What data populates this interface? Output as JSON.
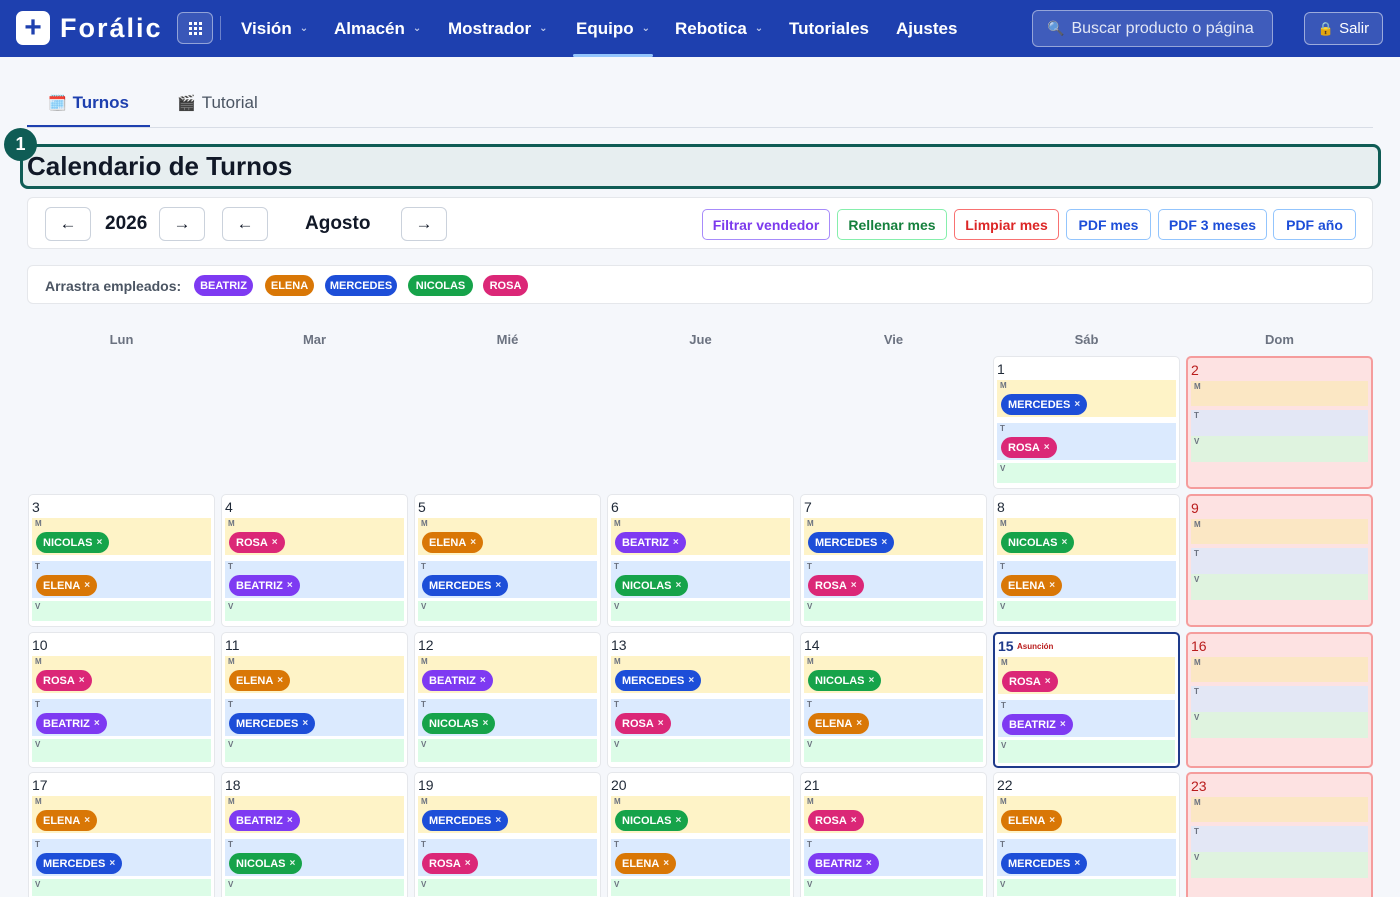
{
  "brand": {
    "name": "Forálic",
    "logo_symbol": "+"
  },
  "nav": {
    "items": [
      {
        "label": "Visión",
        "has_menu": true
      },
      {
        "label": "Almacén",
        "has_menu": true
      },
      {
        "label": "Mostrador",
        "has_menu": true
      },
      {
        "label": "Equipo",
        "has_menu": true,
        "active": true
      },
      {
        "label": "Rebotica",
        "has_menu": true
      },
      {
        "label": "Tutoriales",
        "has_menu": false
      },
      {
        "label": "Ajustes",
        "has_menu": false
      }
    ],
    "search_placeholder": "Buscar producto o página",
    "logout_label": "Salir"
  },
  "tabs": [
    {
      "label": "Turnos",
      "icon": "calendar-icon",
      "active": true
    },
    {
      "label": "Tutorial",
      "icon": "clapperboard-icon",
      "active": false
    }
  ],
  "page": {
    "step_number": "1",
    "title": "Calendario de Turnos"
  },
  "controls": {
    "prev_year": "←",
    "year": "2026",
    "next_year": "→",
    "prev_month": "←",
    "month": "Agosto",
    "next_month": "→",
    "actions": [
      {
        "label": "Filtrar vendedor",
        "style": "purple"
      },
      {
        "label": "Rellenar mes",
        "style": "green"
      },
      {
        "label": "Limpiar mes",
        "style": "red"
      },
      {
        "label": "PDF mes",
        "style": "blue"
      },
      {
        "label": "PDF 3 meses",
        "style": "blue"
      },
      {
        "label": "PDF año",
        "style": "blue"
      }
    ]
  },
  "drag": {
    "label": "Arrastra empleados:",
    "employees": [
      "BEATRIZ",
      "ELENA",
      "MERCEDES",
      "NICOLAS",
      "ROSA"
    ]
  },
  "employee_colors": {
    "BEATRIZ": "#7e3af2",
    "ELENA": "#d97706",
    "MERCEDES": "#1d4ed8",
    "NICOLAS": "#16a34a",
    "ROSA": "#db2777"
  },
  "remove_symbol": "×",
  "weekdays": [
    "Lun",
    "Mar",
    "Mié",
    "Jue",
    "Vie",
    "Sáb",
    "Dom"
  ],
  "shift_labels": [
    "M",
    "T",
    "V"
  ],
  "calendar": {
    "weeks": [
      [
        null,
        null,
        null,
        null,
        null,
        {
          "day": "1",
          "M": "MERCEDES",
          "T": "ROSA"
        },
        {
          "day": "2",
          "sunday": true
        }
      ],
      [
        {
          "day": "3",
          "M": "NICOLAS",
          "T": "ELENA"
        },
        {
          "day": "4",
          "M": "ROSA",
          "T": "BEATRIZ"
        },
        {
          "day": "5",
          "M": "ELENA",
          "T": "MERCEDES"
        },
        {
          "day": "6",
          "M": "BEATRIZ",
          "T": "NICOLAS"
        },
        {
          "day": "7",
          "M": "MERCEDES",
          "T": "ROSA"
        },
        {
          "day": "8",
          "M": "NICOLAS",
          "T": "ELENA"
        },
        {
          "day": "9",
          "sunday": true
        }
      ],
      [
        {
          "day": "10",
          "M": "ROSA",
          "T": "BEATRIZ"
        },
        {
          "day": "11",
          "M": "ELENA",
          "T": "MERCEDES"
        },
        {
          "day": "12",
          "M": "BEATRIZ",
          "T": "NICOLAS"
        },
        {
          "day": "13",
          "M": "MERCEDES",
          "T": "ROSA"
        },
        {
          "day": "14",
          "M": "NICOLAS",
          "T": "ELENA"
        },
        {
          "day": "15",
          "holiday": "Asunción",
          "today": true,
          "M": "ROSA",
          "T": "BEATRIZ"
        },
        {
          "day": "16",
          "sunday": true
        }
      ],
      [
        {
          "day": "17",
          "M": "ELENA",
          "T": "MERCEDES"
        },
        {
          "day": "18",
          "M": "BEATRIZ",
          "T": "NICOLAS"
        },
        {
          "day": "19",
          "M": "MERCEDES",
          "T": "ROSA"
        },
        {
          "day": "20",
          "M": "NICOLAS",
          "T": "ELENA"
        },
        {
          "day": "21",
          "M": "ROSA",
          "T": "BEATRIZ"
        },
        {
          "day": "22",
          "M": "ELENA",
          "T": "MERCEDES"
        },
        {
          "day": "23",
          "sunday": true
        }
      ]
    ]
  }
}
